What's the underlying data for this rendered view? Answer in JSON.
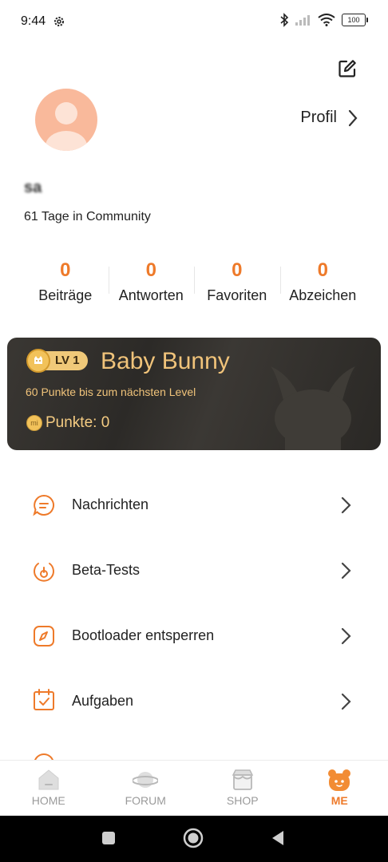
{
  "status_bar": {
    "time": "9:44",
    "battery": "100"
  },
  "header": {
    "edit_icon": "edit-icon"
  },
  "profile": {
    "profile_link_label": "Profil",
    "username": "sa",
    "days_in_community": "61 Tage in Community"
  },
  "stats": [
    {
      "value": "0",
      "label": "Beiträge"
    },
    {
      "value": "0",
      "label": "Antworten"
    },
    {
      "value": "0",
      "label": "Favoriten"
    },
    {
      "value": "0",
      "label": "Abzeichen"
    }
  ],
  "level": {
    "badge": "LV 1",
    "name": "Baby Bunny",
    "next_level_text": "60 Punkte bis zum nächsten Level",
    "points_text": "Punkte: 0",
    "coin_text": "mi"
  },
  "menu": [
    {
      "label": "Nachrichten",
      "icon": "message-icon"
    },
    {
      "label": "Beta-Tests",
      "icon": "beta-icon"
    },
    {
      "label": "Bootloader entsperren",
      "icon": "bootloader-icon"
    },
    {
      "label": "Aufgaben",
      "icon": "calendar-icon"
    }
  ],
  "tabs": [
    {
      "label": "HOME",
      "icon": "home-icon",
      "active": false
    },
    {
      "label": "FORUM",
      "icon": "planet-icon",
      "active": false
    },
    {
      "label": "SHOP",
      "icon": "shop-icon",
      "active": false
    },
    {
      "label": "ME",
      "icon": "bear-icon",
      "active": true
    }
  ],
  "colors": {
    "accent": "#ee7a2a",
    "gold": "#f0c37a",
    "card_bg": "#2f2d2a"
  }
}
